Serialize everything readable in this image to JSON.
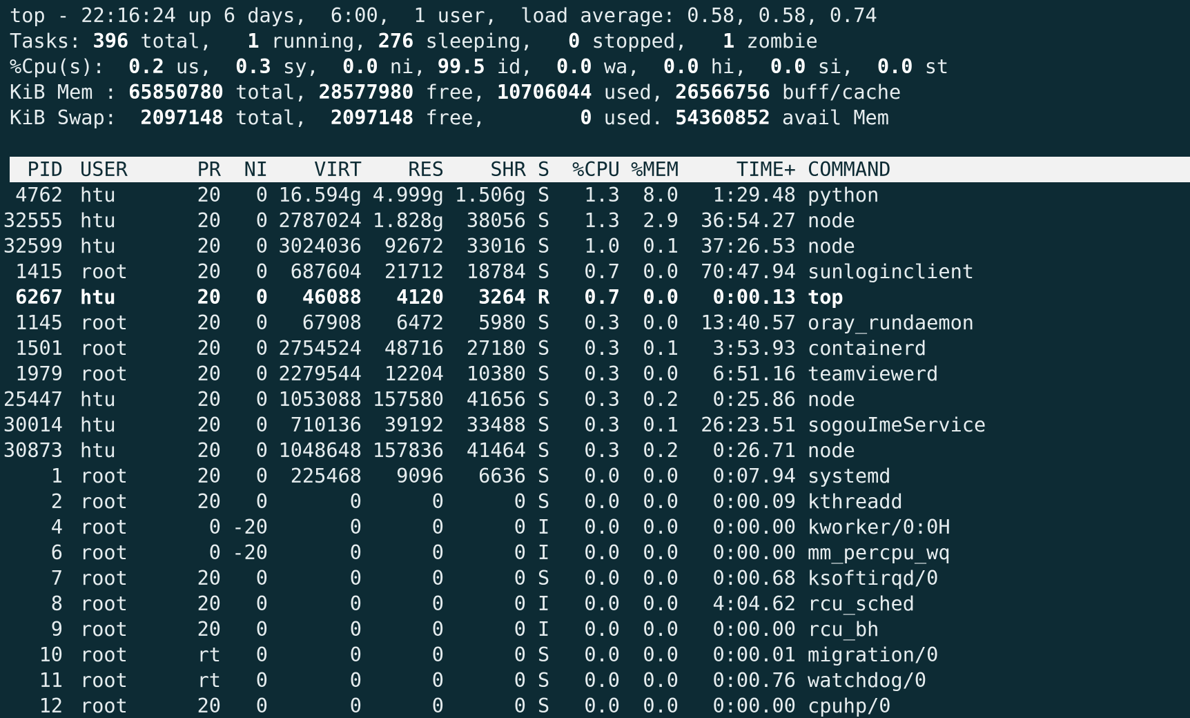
{
  "summary": {
    "uptime": {
      "prefix": "top - ",
      "time": "22:16:24",
      "up": " up 6 days,  6:00,  1 user,  load average: ",
      "load": "0.58, 0.58, 0.74"
    },
    "tasks": {
      "label": "Tasks: ",
      "total": "396",
      "total_label": " total,   ",
      "running": "1",
      "running_label": " running, ",
      "sleeping": "276",
      "sleeping_label": " sleeping,   ",
      "stopped": "0",
      "stopped_label": " stopped,   ",
      "zombie": "1",
      "zombie_label": " zombie"
    },
    "cpu": {
      "label": "%Cpu(s):  ",
      "us": "0.2",
      "us_label": " us,  ",
      "sy": "0.3",
      "sy_label": " sy,  ",
      "ni": "0.0",
      "ni_label": " ni, ",
      "id": "99.5",
      "id_label": " id,  ",
      "wa": "0.0",
      "wa_label": " wa,  ",
      "hi": "0.0",
      "hi_label": " hi,  ",
      "si": "0.0",
      "si_label": " si,  ",
      "st": "0.0",
      "st_label": " st"
    },
    "mem": {
      "label": "KiB Mem : ",
      "total": "65850780",
      "total_label": " total, ",
      "free": "28577980",
      "free_label": " free, ",
      "used": "10706044",
      "used_label": " used, ",
      "buff": "26566756",
      "buff_label": " buff/cache"
    },
    "swap": {
      "label": "KiB Swap:  ",
      "total": "2097148",
      "total_label": " total,  ",
      "free": "2097148",
      "free_label": " free,        ",
      "used": "0",
      "used_label": " used. ",
      "avail": "54360852",
      "avail_label": " avail Mem"
    }
  },
  "columns": [
    "PID",
    "USER",
    "PR",
    "NI",
    "VIRT",
    "RES",
    "SHR",
    "S",
    "%CPU",
    "%MEM",
    "TIME+",
    "COMMAND"
  ],
  "processes": [
    {
      "pid": "4762",
      "user": "htu",
      "pr": "20",
      "ni": "0",
      "virt": "16.594g",
      "res": "4.999g",
      "shr": "1.506g",
      "s": "S",
      "cpu": "1.3",
      "mem": "8.0",
      "time": "1:29.48",
      "command": "python",
      "bold": false
    },
    {
      "pid": "32555",
      "user": "htu",
      "pr": "20",
      "ni": "0",
      "virt": "2787024",
      "res": "1.828g",
      "shr": "38056",
      "s": "S",
      "cpu": "1.3",
      "mem": "2.9",
      "time": "36:54.27",
      "command": "node",
      "bold": false
    },
    {
      "pid": "32599",
      "user": "htu",
      "pr": "20",
      "ni": "0",
      "virt": "3024036",
      "res": "92672",
      "shr": "33016",
      "s": "S",
      "cpu": "1.0",
      "mem": "0.1",
      "time": "37:26.53",
      "command": "node",
      "bold": false
    },
    {
      "pid": "1415",
      "user": "root",
      "pr": "20",
      "ni": "0",
      "virt": "687604",
      "res": "21712",
      "shr": "18784",
      "s": "S",
      "cpu": "0.7",
      "mem": "0.0",
      "time": "70:47.94",
      "command": "sunloginclient",
      "bold": false
    },
    {
      "pid": "6267",
      "user": "htu",
      "pr": "20",
      "ni": "0",
      "virt": "46088",
      "res": "4120",
      "shr": "3264",
      "s": "R",
      "cpu": "0.7",
      "mem": "0.0",
      "time": "0:00.13",
      "command": "top",
      "bold": true
    },
    {
      "pid": "1145",
      "user": "root",
      "pr": "20",
      "ni": "0",
      "virt": "67908",
      "res": "6472",
      "shr": "5980",
      "s": "S",
      "cpu": "0.3",
      "mem": "0.0",
      "time": "13:40.57",
      "command": "oray_rundaemon",
      "bold": false
    },
    {
      "pid": "1501",
      "user": "root",
      "pr": "20",
      "ni": "0",
      "virt": "2754524",
      "res": "48716",
      "shr": "27180",
      "s": "S",
      "cpu": "0.3",
      "mem": "0.1",
      "time": "3:53.93",
      "command": "containerd",
      "bold": false
    },
    {
      "pid": "1979",
      "user": "root",
      "pr": "20",
      "ni": "0",
      "virt": "2279544",
      "res": "12204",
      "shr": "10380",
      "s": "S",
      "cpu": "0.3",
      "mem": "0.0",
      "time": "6:51.16",
      "command": "teamviewerd",
      "bold": false
    },
    {
      "pid": "25447",
      "user": "htu",
      "pr": "20",
      "ni": "0",
      "virt": "1053088",
      "res": "157580",
      "shr": "41656",
      "s": "S",
      "cpu": "0.3",
      "mem": "0.2",
      "time": "0:25.86",
      "command": "node",
      "bold": false
    },
    {
      "pid": "30014",
      "user": "htu",
      "pr": "20",
      "ni": "0",
      "virt": "710136",
      "res": "39192",
      "shr": "33488",
      "s": "S",
      "cpu": "0.3",
      "mem": "0.1",
      "time": "26:23.51",
      "command": "sogouImeService",
      "bold": false
    },
    {
      "pid": "30873",
      "user": "htu",
      "pr": "20",
      "ni": "0",
      "virt": "1048648",
      "res": "157836",
      "shr": "41464",
      "s": "S",
      "cpu": "0.3",
      "mem": "0.2",
      "time": "0:26.71",
      "command": "node",
      "bold": false
    },
    {
      "pid": "1",
      "user": "root",
      "pr": "20",
      "ni": "0",
      "virt": "225468",
      "res": "9096",
      "shr": "6636",
      "s": "S",
      "cpu": "0.0",
      "mem": "0.0",
      "time": "0:07.94",
      "command": "systemd",
      "bold": false
    },
    {
      "pid": "2",
      "user": "root",
      "pr": "20",
      "ni": "0",
      "virt": "0",
      "res": "0",
      "shr": "0",
      "s": "S",
      "cpu": "0.0",
      "mem": "0.0",
      "time": "0:00.09",
      "command": "kthreadd",
      "bold": false
    },
    {
      "pid": "4",
      "user": "root",
      "pr": "0",
      "ni": "-20",
      "virt": "0",
      "res": "0",
      "shr": "0",
      "s": "I",
      "cpu": "0.0",
      "mem": "0.0",
      "time": "0:00.00",
      "command": "kworker/0:0H",
      "bold": false
    },
    {
      "pid": "6",
      "user": "root",
      "pr": "0",
      "ni": "-20",
      "virt": "0",
      "res": "0",
      "shr": "0",
      "s": "I",
      "cpu": "0.0",
      "mem": "0.0",
      "time": "0:00.00",
      "command": "mm_percpu_wq",
      "bold": false
    },
    {
      "pid": "7",
      "user": "root",
      "pr": "20",
      "ni": "0",
      "virt": "0",
      "res": "0",
      "shr": "0",
      "s": "S",
      "cpu": "0.0",
      "mem": "0.0",
      "time": "0:00.68",
      "command": "ksoftirqd/0",
      "bold": false
    },
    {
      "pid": "8",
      "user": "root",
      "pr": "20",
      "ni": "0",
      "virt": "0",
      "res": "0",
      "shr": "0",
      "s": "I",
      "cpu": "0.0",
      "mem": "0.0",
      "time": "4:04.62",
      "command": "rcu_sched",
      "bold": false
    },
    {
      "pid": "9",
      "user": "root",
      "pr": "20",
      "ni": "0",
      "virt": "0",
      "res": "0",
      "shr": "0",
      "s": "I",
      "cpu": "0.0",
      "mem": "0.0",
      "time": "0:00.00",
      "command": "rcu_bh",
      "bold": false
    },
    {
      "pid": "10",
      "user": "root",
      "pr": "rt",
      "ni": "0",
      "virt": "0",
      "res": "0",
      "shr": "0",
      "s": "S",
      "cpu": "0.0",
      "mem": "0.0",
      "time": "0:00.01",
      "command": "migration/0",
      "bold": false
    },
    {
      "pid": "11",
      "user": "root",
      "pr": "rt",
      "ni": "0",
      "virt": "0",
      "res": "0",
      "shr": "0",
      "s": "S",
      "cpu": "0.0",
      "mem": "0.0",
      "time": "0:00.76",
      "command": "watchdog/0",
      "bold": false
    },
    {
      "pid": "12",
      "user": "root",
      "pr": "20",
      "ni": "0",
      "virt": "0",
      "res": "0",
      "shr": "0",
      "s": "S",
      "cpu": "0.0",
      "mem": "0.0",
      "time": "0:00.00",
      "command": "cpuhp/0",
      "bold": false
    }
  ],
  "colors": {
    "background": "#0d2b34",
    "foreground": "#e6edef",
    "header_bg": "#f2f2f2",
    "header_fg": "#0d2b34"
  }
}
